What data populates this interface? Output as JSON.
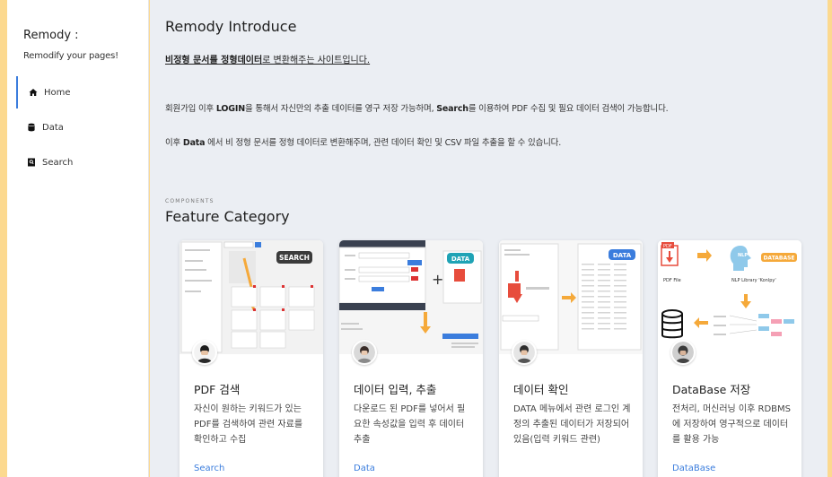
{
  "sidebar": {
    "title": "Remody :",
    "subtitle": "Remodify your pages!",
    "items": [
      {
        "label": "Home",
        "icon": "home-icon",
        "active": true
      },
      {
        "label": "Data",
        "icon": "database-icon",
        "active": false
      },
      {
        "label": "Search",
        "icon": "search-book-icon",
        "active": false
      }
    ]
  },
  "intro": {
    "title": "Remody Introduce",
    "desc_bold": "비정형 문서를 정형데이터",
    "desc_rest": "로 변환해주는 사이트입니다.",
    "line1_a": "회원가입 이후 ",
    "line1_b": "LOGIN",
    "line1_c": "을 통해서 자신만의 추출 데이터를 영구 저장 가능하며, ",
    "line1_d": "Search",
    "line1_e": "를 이용하여 PDF 수집 및 필요 데이터 검색이 가능합니다.",
    "line2_a": "이후 ",
    "line2_b": "Data",
    "line2_c": " 에서 비 정형 문서를 정형 데이터로 변환해주며, 관련 데이터 확인 및 CSV 파일 추출을 할 수 있습니다."
  },
  "components": {
    "label": "COMPONENTS",
    "title": "Feature Category"
  },
  "cards": [
    {
      "title": "PDF 검색",
      "text": "자신이 원하는 키워드가 있는 PDF를 검색하여 관련 자료를 확인하고 수집",
      "link": "Search",
      "badge": "SEARCH"
    },
    {
      "title": "데이터 입력, 추출",
      "text": "다운로드 된 PDF를 넣어서 필요한 속성값을 입력 후 데이터 추출",
      "link": "Data",
      "badge": "DATA"
    },
    {
      "title": "데이터 확인",
      "text": "DATA 메뉴에서 관련 로그인 계정의 추출된 데이터가 저장되어 있음(입력 키워드 관련)",
      "link": "Data",
      "badge": "DATA"
    },
    {
      "title": "DataBase 저장",
      "text": "전처리, 머신러닝 이후 RDBMS에 저장하여 영구적으로 데이터를 활용 가능",
      "link": "DataBase",
      "badge": "DATABASE",
      "thumb_labels": [
        "PDF File",
        "NLP Library 'Konlpy'",
        "NLP",
        "PDF"
      ]
    }
  ],
  "colors": {
    "background": "#fcd98f",
    "main": "#ebeef3",
    "accent": "#3b7ddd",
    "arrow": "#f5a93a"
  }
}
